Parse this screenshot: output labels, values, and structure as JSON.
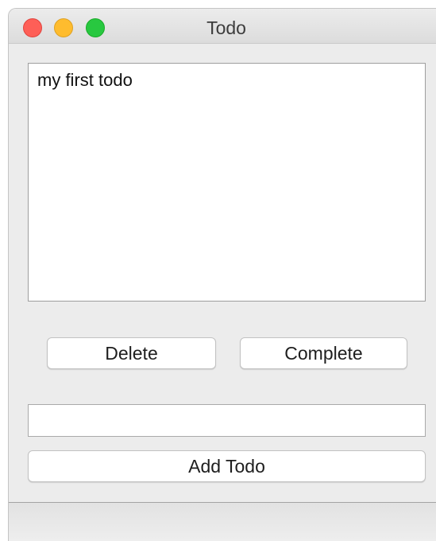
{
  "window": {
    "title": "Todo"
  },
  "todo_list": {
    "items": [
      "my first todo"
    ]
  },
  "buttons": {
    "delete_label": "Delete",
    "complete_label": "Complete",
    "add_label": "Add Todo"
  },
  "input": {
    "value": ""
  },
  "colors": {
    "close": "#fe5f57",
    "minimize": "#febc2e",
    "zoom": "#28c840",
    "window_background": "#ececec"
  }
}
